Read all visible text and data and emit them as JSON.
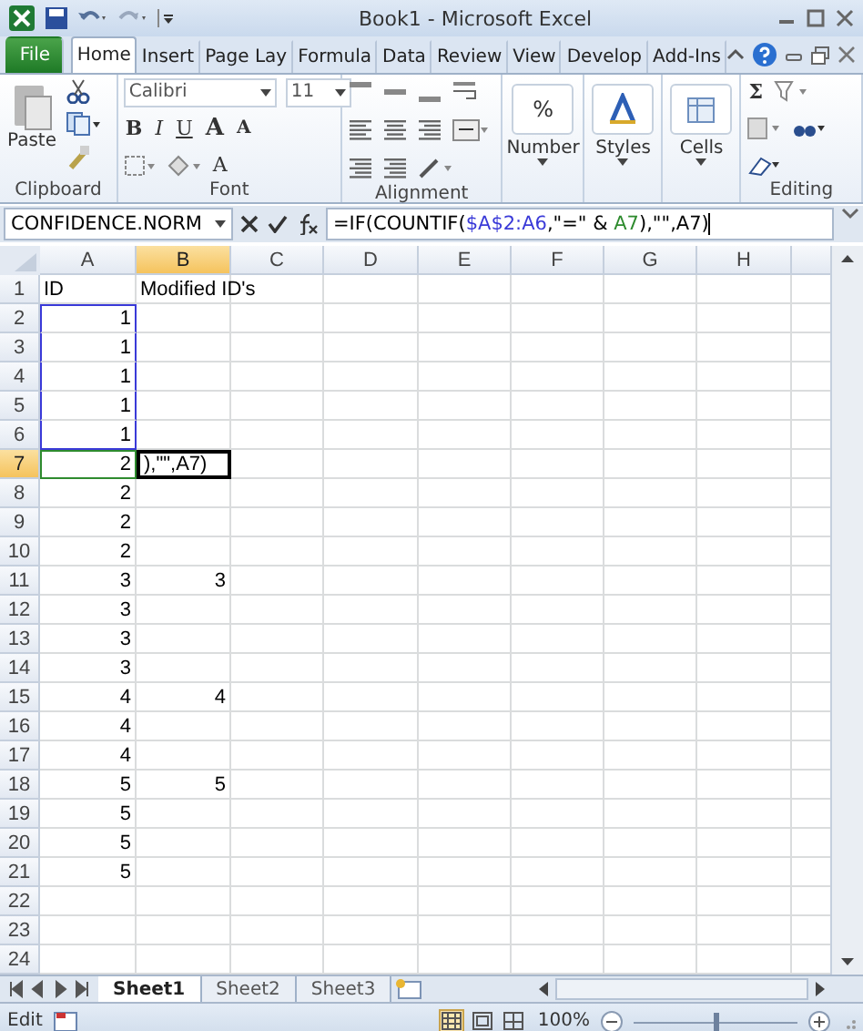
{
  "window": {
    "title": "Book1 - Microsoft Excel"
  },
  "quick_access": [
    {
      "kind": "save"
    },
    {
      "kind": "undo"
    },
    {
      "kind": "redo"
    },
    {
      "kind": "customize"
    }
  ],
  "tabs": [
    {
      "label": "File",
      "kind": "file",
      "selected": false
    },
    {
      "label": "Home",
      "kind": "tab",
      "selected": true
    },
    {
      "label": "Insert",
      "kind": "tab",
      "selected": false
    },
    {
      "label": "Page Lay",
      "kind": "tab",
      "selected": false
    },
    {
      "label": "Formula",
      "kind": "tab",
      "selected": false
    },
    {
      "label": "Data",
      "kind": "tab",
      "selected": false
    },
    {
      "label": "Review",
      "kind": "tab",
      "selected": false
    },
    {
      "label": "View",
      "kind": "tab",
      "selected": false
    },
    {
      "label": "Develop",
      "kind": "tab",
      "selected": false
    },
    {
      "label": "Add-Ins",
      "kind": "tab",
      "selected": false
    }
  ],
  "ribbon": {
    "clipboard": {
      "label": "Clipboard",
      "paste": "Paste"
    },
    "font": {
      "label": "Font",
      "name": "Calibri",
      "size": "11",
      "bold": "B",
      "italic": "I",
      "underline": "U",
      "grow": "A",
      "shrink": "A",
      "font_color": "A"
    },
    "alignment": {
      "label": "Alignment"
    },
    "number": {
      "label": "Number",
      "symbol": "%"
    },
    "styles": {
      "label": "Styles"
    },
    "cells": {
      "label": "Cells"
    },
    "editing": {
      "label": "Editing",
      "sum": "Σ"
    }
  },
  "formula_bar": {
    "name_box": "CONFIDENCE.NORM",
    "formula": [
      {
        "text": "=IF(COUNTIF("
      },
      {
        "text": "$A$2:A6",
        "color": "#3a3ad8"
      },
      {
        "text": ",\"=\" & "
      },
      {
        "text": "A7",
        "color": "#2e8b2e"
      },
      {
        "text": "),\"\",A7)"
      }
    ]
  },
  "sheet": {
    "columns": [
      {
        "label": "A",
        "selected": false
      },
      {
        "label": "B",
        "selected": true
      },
      {
        "label": "C",
        "selected": false
      },
      {
        "label": "D",
        "selected": false
      },
      {
        "label": "E",
        "selected": false
      },
      {
        "label": "F",
        "selected": false
      },
      {
        "label": "G",
        "selected": false
      },
      {
        "label": "H",
        "selected": false
      }
    ],
    "rows": [
      {
        "header": "1",
        "selected": false,
        "cells": [
          "ID",
          "Modified ID's"
        ]
      },
      {
        "header": "2",
        "selected": false,
        "cells": [
          "1"
        ],
        "color": "#3a3ad8"
      },
      {
        "header": "3",
        "selected": false,
        "cells": [
          "1"
        ],
        "color": "#3a3ad8"
      },
      {
        "header": "4",
        "selected": false,
        "cells": [
          "1"
        ],
        "color": "#3a3ad8"
      },
      {
        "header": "5",
        "selected": false,
        "cells": [
          "1"
        ],
        "color": "#3a3ad8"
      },
      {
        "header": "6",
        "selected": false,
        "cells": [
          "1"
        ],
        "color": "#3a3ad8"
      },
      {
        "header": "7",
        "selected": true,
        "cells": [
          "2",
          "),\"\",A7)"
        ],
        "color": "#2e8b2e"
      },
      {
        "header": "8",
        "selected": false,
        "cells": [
          "2"
        ]
      },
      {
        "header": "9",
        "selected": false,
        "cells": [
          "2"
        ]
      },
      {
        "header": "10",
        "selected": false,
        "cells": [
          "2"
        ]
      },
      {
        "header": "11",
        "selected": false,
        "cells": [
          "3",
          "3"
        ]
      },
      {
        "header": "12",
        "selected": false,
        "cells": [
          "3"
        ]
      },
      {
        "header": "13",
        "selected": false,
        "cells": [
          "3"
        ]
      },
      {
        "header": "14",
        "selected": false,
        "cells": [
          "3"
        ]
      },
      {
        "header": "15",
        "selected": false,
        "cells": [
          "4",
          "4"
        ]
      },
      {
        "header": "16",
        "selected": false,
        "cells": [
          "4"
        ]
      },
      {
        "header": "17",
        "selected": false,
        "cells": [
          "4"
        ]
      },
      {
        "header": "18",
        "selected": false,
        "cells": [
          "5",
          "5"
        ]
      },
      {
        "header": "19",
        "selected": false,
        "cells": [
          "5"
        ]
      },
      {
        "header": "20",
        "selected": false,
        "cells": [
          "5"
        ]
      },
      {
        "header": "21",
        "selected": false,
        "cells": [
          "5"
        ]
      },
      {
        "header": "22",
        "selected": false
      },
      {
        "header": "23",
        "selected": false
      },
      {
        "header": "24",
        "selected": false
      }
    ]
  },
  "sheet_tabs": [
    {
      "label": "Sheet1",
      "selected": true
    },
    {
      "label": "Sheet2",
      "selected": false
    },
    {
      "label": "Sheet3",
      "selected": false
    }
  ],
  "status_bar": {
    "mode": "Edit",
    "views": [
      {
        "kind": "normal",
        "selected": true
      },
      {
        "kind": "layout",
        "selected": false
      },
      {
        "kind": "pagebreak",
        "selected": false
      }
    ],
    "zoom": "100%",
    "zoom_slider": {
      "level": 0.5
    }
  }
}
